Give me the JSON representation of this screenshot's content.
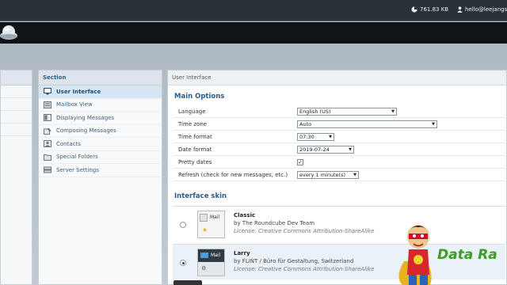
{
  "topbar": {
    "quota": "761.83 KB",
    "user": "hello@leejangs"
  },
  "section_panel": {
    "title": "Section",
    "items": [
      {
        "label": "User Interface",
        "icon": "monitor-icon"
      },
      {
        "label": "Mailbox View",
        "icon": "mailbox-icon"
      },
      {
        "label": "Displaying Messages",
        "icon": "message-view-icon"
      },
      {
        "label": "Composing Messages",
        "icon": "compose-icon"
      },
      {
        "label": "Contacts",
        "icon": "contacts-icon"
      },
      {
        "label": "Special Folders",
        "icon": "folder-icon"
      },
      {
        "label": "Server Settings",
        "icon": "server-icon"
      }
    ]
  },
  "content": {
    "header": "User Interface",
    "main_options": {
      "title": "Main Options",
      "rows": [
        {
          "label": "Language",
          "value": "English (US)"
        },
        {
          "label": "Time zone",
          "value": "Auto"
        },
        {
          "label": "Time format",
          "value": "07:30"
        },
        {
          "label": "Date format",
          "value": "2019-07-24"
        },
        {
          "label": "Pretty dates",
          "checked": true
        },
        {
          "label": "Refresh (check for new messages, etc.)",
          "value": "every 1 minute(s)"
        }
      ]
    },
    "interface_skin": {
      "title": "Interface skin",
      "skins": [
        {
          "name": "Classic",
          "by": "by The Roundcube Dev Team",
          "license": "License: Creative Commons Attribution-ShareAlike",
          "thumb_label": "Mail",
          "selected": false
        },
        {
          "name": "Larry",
          "by": "by FLINT / Büro für Gestaltung, Switzerland",
          "license": "License: Creative Commons Attribution-ShareAlike",
          "thumb_label": "Mail",
          "selected": true
        }
      ]
    }
  },
  "watermark": "Data Ra",
  "colors": {
    "topbar": "#2a3138",
    "header": "#111417",
    "accent": "#2c5c86",
    "selected_row": "#d4e6f3",
    "watermark": "#3f9b2d"
  }
}
